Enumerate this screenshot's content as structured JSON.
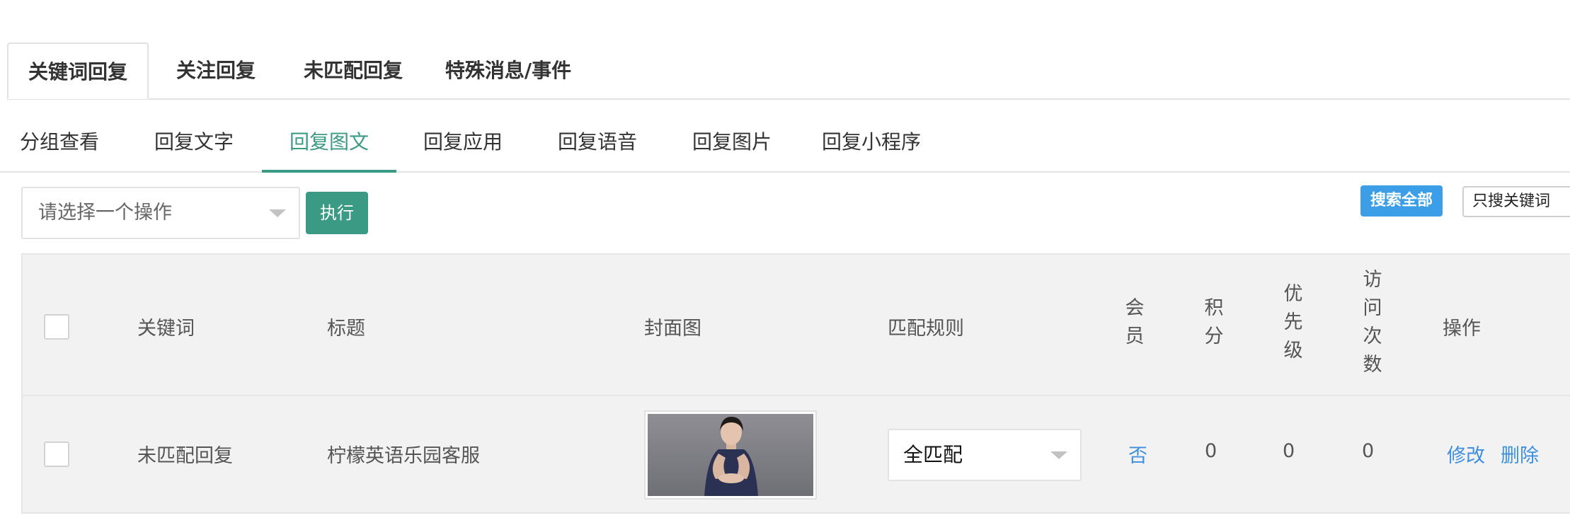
{
  "top_tabs": [
    {
      "label": "关键词回复",
      "active": true
    },
    {
      "label": "关注回复",
      "active": false
    },
    {
      "label": "未匹配回复",
      "active": false
    },
    {
      "label": "特殊消息/事件",
      "active": false
    }
  ],
  "sub_tabs": [
    {
      "label": "分组查看",
      "active": false
    },
    {
      "label": "回复文字",
      "active": false
    },
    {
      "label": "回复图文",
      "active": true
    },
    {
      "label": "回复应用",
      "active": false
    },
    {
      "label": "回复语音",
      "active": false
    },
    {
      "label": "回复图片",
      "active": false
    },
    {
      "label": "回复小程序",
      "active": false
    }
  ],
  "toolbar": {
    "operation_placeholder": "请选择一个操作",
    "execute_label": "执行",
    "search_all_label": "搜索全部",
    "search_keyword_label": "只搜关键词"
  },
  "table": {
    "headers": {
      "keyword": "关键词",
      "title": "标题",
      "cover": "封面图",
      "match_rule": "匹配规则",
      "member": [
        "会",
        "员"
      ],
      "points": [
        "积",
        "分"
      ],
      "priority": [
        "优",
        "先",
        "级"
      ],
      "visits": [
        "访",
        "问",
        "次",
        "数"
      ],
      "actions": "操作"
    },
    "rows": [
      {
        "keyword": "未匹配回复",
        "title": "柠檬英语乐园客服",
        "cover_icon": "portrait-photo",
        "match_rule": "全匹配",
        "member": "否",
        "points": "0",
        "priority": "0",
        "visits": "0",
        "edit_label": "修改",
        "delete_label": "删除"
      }
    ]
  },
  "colors": {
    "accent_green": "#3a9a84",
    "button_blue": "#3d9ee8",
    "link_blue": "#3d8fe0",
    "table_bg": "#f2f2f2"
  }
}
